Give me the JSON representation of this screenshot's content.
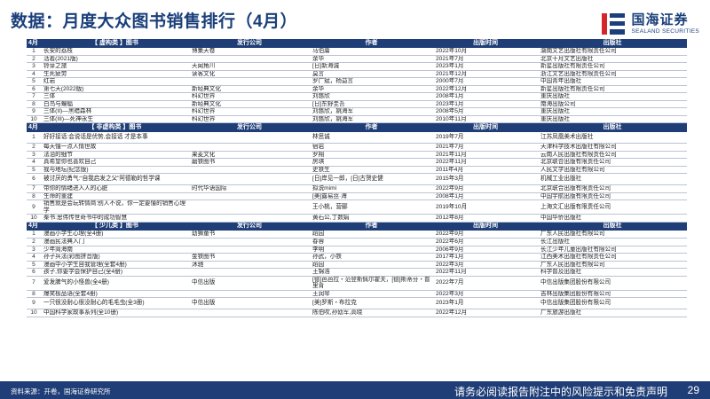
{
  "title": "数据：月度大众图书销售排行（4月）",
  "logo": {
    "cn": "国海证券",
    "en": "SEALAND SECURITIES"
  },
  "columns": {
    "name": "",
    "publisher_brand": "发行公司",
    "author": "作者",
    "date": "出版时间",
    "press": "出版社"
  },
  "sections": [
    {
      "month": "4月",
      "category": "【 虚构类 】图书",
      "rows": [
        {
          "rank": "1",
          "name": "长安的荔枝",
          "brand": "博集天卷",
          "author": "马伯庸",
          "date": "2022年10月",
          "press": "湖南文艺出版社有限责任公司",
          "h": 8.5
        },
        {
          "rank": "2",
          "name": "活着(2021版)",
          "brand": "",
          "author": "余华",
          "date": "2021年7月",
          "press": "北京十月文艺出版社",
          "h": 8.5
        },
        {
          "rank": "3",
          "name": "铃芽之旅",
          "brand": "天闻角川",
          "author": "[日]新海诚",
          "date": "2023年1月",
          "press": "新星出版社有限责任公司",
          "h": 8.5
        },
        {
          "rank": "4",
          "name": "生死疲劳",
          "brand": "读客文化",
          "author": "莫言",
          "date": "2021年12月",
          "press": "浙江文艺出版社有限责任公司",
          "h": 8.5
        },
        {
          "rank": "5",
          "name": "红岩",
          "brand": "",
          "author": "罗广斌，杨益言",
          "date": "2000年7月",
          "press": "中国青年出版社",
          "h": 8.5
        },
        {
          "rank": "6",
          "name": "第七天(2022版)",
          "brand": "新经典文化",
          "author": "余华",
          "date": "2022年12月",
          "press": "新星出版社有限责任公司",
          "h": 8.5
        },
        {
          "rank": "7",
          "name": "三体",
          "brand": "科幻世界",
          "author": "刘慈欣",
          "date": "2008年1月",
          "press": "重庆出版社",
          "h": 8.5
        },
        {
          "rank": "8",
          "name": "白鸟与蝙蝠",
          "brand": "新经典文化",
          "author": "[日]东野圭吾",
          "date": "2023年1月",
          "press": "南海出版公司",
          "h": 8.5
        },
        {
          "rank": "9",
          "name": "三体(II)—黑暗森林",
          "brand": "科幻世界",
          "author": "刘慈欣，姚海军",
          "date": "2008年5月",
          "press": "重庆出版社",
          "h": 8.5
        },
        {
          "rank": "10",
          "name": "三体(III)—死神永生",
          "brand": "科幻世界",
          "author": "刘慈欣，姚海军",
          "date": "2010年11月",
          "press": "重庆出版社",
          "h": 8.5
        }
      ]
    },
    {
      "month": "4月",
      "category": "【 非虚构类 】图书",
      "rows": [
        {
          "rank": "1",
          "name": "好好接话:会说话是优势,会接话 才是本事",
          "brand": "",
          "author": "林思诚",
          "date": "2019年7月",
          "press": "江苏凤凰美术出版社",
          "h": 13
        },
        {
          "rank": "2",
          "name": "每天懂一点人情世故",
          "brand": "",
          "author": "宿岩",
          "date": "2021年7月",
          "press": "天津科学技术出版社有限公司",
          "h": 8.5
        },
        {
          "rank": "3",
          "name": "法治的细节",
          "brand": "果麦文化",
          "author": "罗翔",
          "date": "2021年11月",
          "press": "云南人民出版社有限责任公司",
          "h": 8.5
        },
        {
          "rank": "4",
          "name": "真希望你也喜欢自己",
          "brand": "磨铁图书",
          "author": "房琪",
          "date": "2022年11月",
          "press": "北京联合出版有限责任公司",
          "h": 8.5
        },
        {
          "rank": "5",
          "name": "我与地坛(纪念版)",
          "brand": "",
          "author": "史铁生",
          "date": "2011年4月",
          "press": "人民文学出版社有限公司",
          "h": 8.5
        },
        {
          "rank": "6",
          "name": "被讨厌的勇气:“自我启发之父”阿德勒的哲学课",
          "brand": "",
          "author": "[日]岸见一郎，[日]古贺史健",
          "date": "2015年3月",
          "press": "机械工业出版社",
          "h": 13
        },
        {
          "rank": "7",
          "name": "带你的情绪进入人的心脏",
          "brand": "时代华语国际",
          "author": "拟说mimi",
          "date": "2022年9月",
          "press": "北京联合出版有限责任公司",
          "h": 8.5
        },
        {
          "rank": "8",
          "name": "生命的重建",
          "brand": "",
          "author": "[美]露易丝·海",
          "date": "2008年1月",
          "press": "中国宇航出版有限责任公司",
          "h": 8.5
        },
        {
          "rank": "9",
          "name": "销售就是会玩转情商:别人不说，你一定要懂的销售心理学",
          "brand": "",
          "author": "王小桃，营郦",
          "date": "2019年10月",
          "press": "上海文汇出版有限责任公司",
          "h": 16
        },
        {
          "rank": "10",
          "name": "秦书:思伟传世奇书中的成功智慧",
          "brand": "",
          "author": "黄石公,丁数娟",
          "date": "2012年8月",
          "press": "中国华侨出版社",
          "h": 8.5
        }
      ]
    },
    {
      "month": "4月",
      "category": "【 少儿类 】图书",
      "rows": [
        {
          "rank": "1",
          "name": "漫画小学生心理(全4册)",
          "brand": "幼狮童书",
          "author": "蹈园",
          "date": "2022年9月",
          "press": "广东人民出版社有限公司",
          "h": 8.5
        },
        {
          "rank": "2",
          "name": "漫画民法典入门",
          "brand": "",
          "author": "春蓉",
          "date": "2022年6月",
          "press": "长江出版社",
          "h": 8.5
        },
        {
          "rank": "3",
          "name": "少年简海南",
          "brand": "",
          "author": "李明",
          "date": "2006年9月",
          "press": "长江少年儿童出版社有限公司",
          "h": 8.5
        },
        {
          "rank": "4",
          "name": "孙子兵法(彩图拼音版)",
          "brand": "金铁图书",
          "author": "孙武，小铁",
          "date": "2017年1月",
          "press": "江西美术出版社有限责任公司",
          "h": 8.5
        },
        {
          "rank": "5",
          "name": "漫画中小学生自我管理(全套4册)",
          "brand": "沐驰",
          "author": "蹈园",
          "date": "2022年3月",
          "press": "广东人民出版社有限公司",
          "h": 8.5
        },
        {
          "rank": "6",
          "name": "孩子,你要学会保护自己(全4册)",
          "brand": "",
          "author": "王锦浩",
          "date": "2022年11月",
          "press": "科学普及出版社",
          "h": 8.5
        },
        {
          "rank": "7",
          "name": "爱发脾气的小怪兽(全4册)",
          "brand": "中信出版",
          "author": "[德]芭芭拉・范登斯佩尔霍夫，[德]斯蒂芬・普里肯",
          "date": "2022年7月",
          "press": "中信出版集团股份有限公司",
          "h": 16
        },
        {
          "rank": "8",
          "name": "爆笑极品语(全套4册)",
          "brand": "",
          "author": "王润琴",
          "date": "2022年3月",
          "press": "吉林出版集团股份有限公司",
          "h": 8.5
        },
        {
          "rank": "9",
          "name": "一只很没耐心很没耐心的毛毛虫(全3册)",
          "brand": "中信出版",
          "author": "[美]罗斯・布拉克",
          "date": "2023年1月",
          "press": "中信出版集团股份有限公司",
          "h": 13
        },
        {
          "rank": "10",
          "name": "中国科学家故事系列(全10册)",
          "brand": "",
          "author": "陈伯吹,孙幼军,高晓",
          "date": "2022年12月",
          "press": "广东旅游出版社",
          "h": 8.5
        }
      ]
    }
  ],
  "footer": {
    "source": "资料来源：开卷，国海证券研究所",
    "disclaimer": "请务必阅读报告附注中的风险提示和免责声明",
    "page": "29"
  },
  "colors": {
    "brand_blue": "#1f3e77",
    "title_blue": "#1a3f7a",
    "logo_red": "#d6262b"
  }
}
